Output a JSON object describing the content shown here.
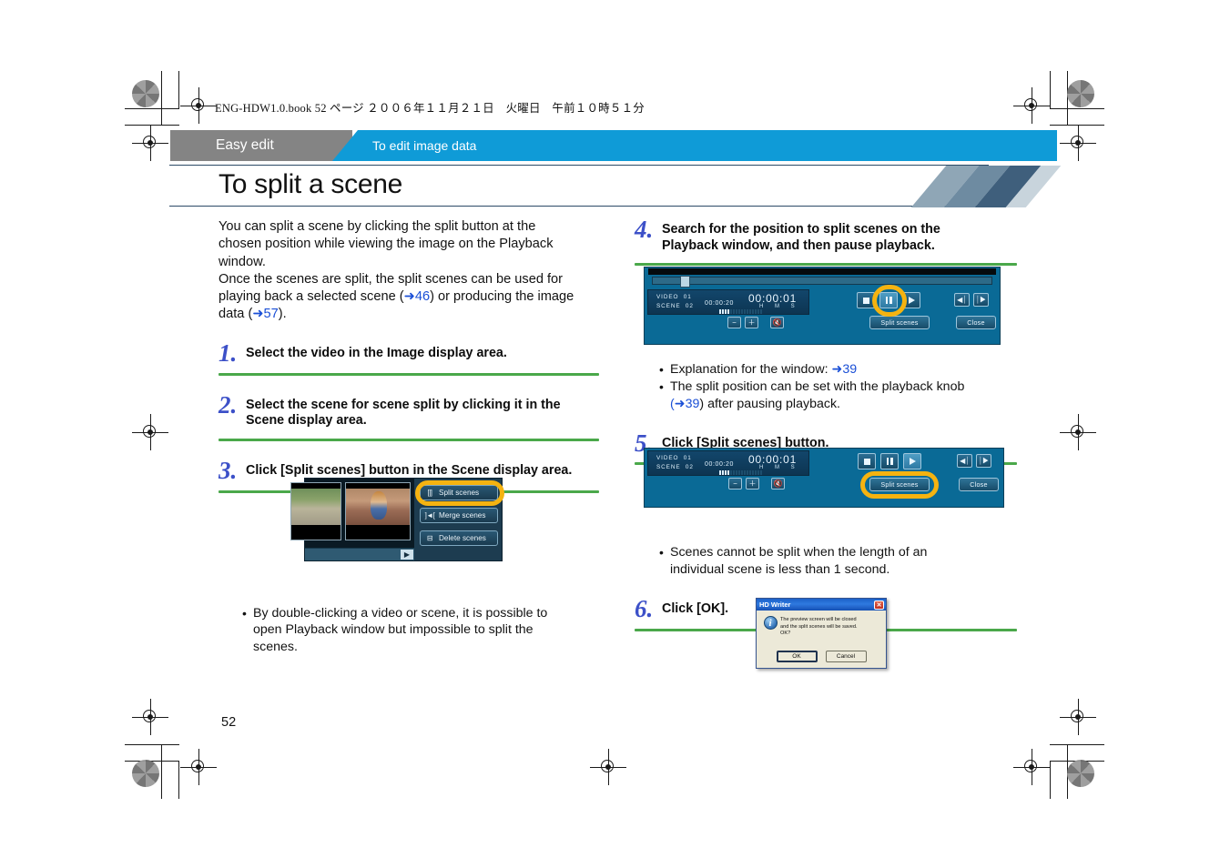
{
  "file_header": "ENG-HDW1.0.book   52 ページ   ２００６年１１月２１日　火曜日　午前１０時５１分",
  "breadcrumb": {
    "section": "Easy edit",
    "subsection": "To edit image data"
  },
  "page_title": "To split a scene",
  "page_number": "52",
  "intro": {
    "line1": "You can split a scene by clicking the split button at the",
    "line2": "chosen position while viewing the image on the Playback",
    "line3": "window.",
    "line4": "Once the scenes are split, the split scenes can be used for",
    "line5_a": "playing back a selected scene (",
    "ref_46": "➜46",
    "line5_b": ") or producing the image",
    "line6_a": "data (",
    "ref_57": "➜57",
    "line6_b": ")."
  },
  "steps": [
    {
      "num": "1.",
      "text": "Select the video in the Image display area."
    },
    {
      "num": "2.",
      "text_line1": "Select the scene for scene split by clicking it in the",
      "text_line2": "Scene display area."
    },
    {
      "num": "3.",
      "text": "Click [Split scenes] button in the Scene display area."
    },
    {
      "num": "4.",
      "text_line1": "Search for the position to split scenes on the",
      "text_line2": "Playback window, and then pause playback."
    },
    {
      "num": "5.",
      "text": "Click [Split scenes] button."
    },
    {
      "num": "6.",
      "text": "Click [OK]."
    }
  ],
  "scene_shot": {
    "buttons": [
      {
        "icon": "split-icon",
        "icon_glyph": "[|]",
        "label": "Split scenes"
      },
      {
        "icon": "merge-icon",
        "icon_glyph": "]◄[",
        "label": "Merge scenes"
      },
      {
        "icon": "delete-icon",
        "icon_glyph": "⊟",
        "label": "Delete scenes"
      }
    ],
    "highlighted_button": "Split scenes"
  },
  "step3_note": {
    "bullet": "•",
    "line1": "By double-clicking a video or scene, it is possible to",
    "line2": "open Playback window but impossible to split the",
    "line3": "scenes."
  },
  "playback_shot_4": {
    "video_label": "VIDEO",
    "video_value": "01",
    "scene_label": "SCENE",
    "scene_value": "02",
    "elapsed": "00:00:20",
    "time": "00:00:01",
    "hms": "H  M  S",
    "split_button": "Split scenes",
    "close_button": "Close",
    "highlighted_button": "pause-button"
  },
  "step4_notes": [
    {
      "bullet": "•",
      "text_a": "Explanation for the window: ",
      "ref": "➜39",
      "text_b": ""
    },
    {
      "bullet": "•",
      "line1": "The split position can be set with the playback knob",
      "line2_a": "(",
      "ref": "➜39",
      "line2_b": ") after pausing playback."
    }
  ],
  "playback_shot_5": {
    "video_label": "VIDEO",
    "video_value": "01",
    "scene_label": "SCENE",
    "scene_value": "02",
    "elapsed": "00:00:20",
    "time": "00:00:01",
    "hms": "H  M  S",
    "split_button": "Split scenes",
    "close_button": "Close",
    "highlighted_button": "split-scenes-button"
  },
  "step5_note": {
    "bullet": "•",
    "line1": "Scenes cannot be split when the length of an",
    "line2": "individual scene is less than 1 second."
  },
  "dialog": {
    "title": "HD Writer",
    "close_glyph": "✕",
    "icon": "info-icon",
    "icon_glyph": "i",
    "message_line1": "The preview screen will be closed",
    "message_line2": "and the split scenes will be saved.",
    "message_line3": "OK?",
    "ok_button": "OK",
    "cancel_button": "Cancel"
  },
  "colors": {
    "accent_blue": "#0f9bd7",
    "crumb_gray": "#848484",
    "rule_green": "#4aa84a",
    "step_number": "#3c50c8",
    "reference_link": "#1a4fd6",
    "highlight_ring": "#f5b310"
  }
}
